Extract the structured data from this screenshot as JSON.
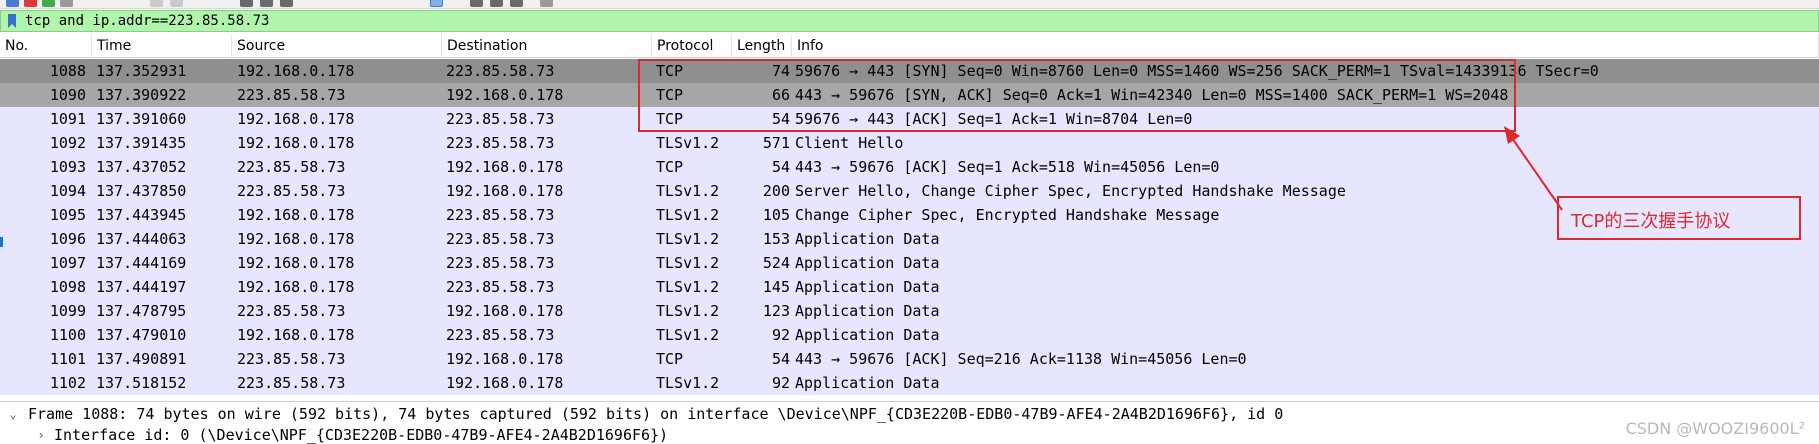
{
  "filter": {
    "expression": "tcp and ip.addr==223.85.58.73"
  },
  "columns": [
    "No.",
    "Time",
    "Source",
    "Destination",
    "Protocol",
    "Length",
    "Info"
  ],
  "packets": [
    {
      "no": "1088",
      "time": "137.352931",
      "src": "192.168.0.178",
      "dst": "223.85.58.73",
      "proto": "TCP",
      "len": "74",
      "info": "59676 → 443 [SYN] Seq=0 Win=8760 Len=0 MSS=1460 WS=256 SACK_PERM=1 TSval=14339136 TSecr=0"
    },
    {
      "no": "1090",
      "time": "137.390922",
      "src": "223.85.58.73",
      "dst": "192.168.0.178",
      "proto": "TCP",
      "len": "66",
      "info": "443 → 59676 [SYN, ACK] Seq=0 Ack=1 Win=42340 Len=0 MSS=1400 SACK_PERM=1 WS=2048"
    },
    {
      "no": "1091",
      "time": "137.391060",
      "src": "192.168.0.178",
      "dst": "223.85.58.73",
      "proto": "TCP",
      "len": "54",
      "info": "59676 → 443 [ACK] Seq=1 Ack=1 Win=8704 Len=0"
    },
    {
      "no": "1092",
      "time": "137.391435",
      "src": "192.168.0.178",
      "dst": "223.85.58.73",
      "proto": "TLSv1.2",
      "len": "571",
      "info": "Client Hello"
    },
    {
      "no": "1093",
      "time": "137.437052",
      "src": "223.85.58.73",
      "dst": "192.168.0.178",
      "proto": "TCP",
      "len": "54",
      "info": "443 → 59676 [ACK] Seq=1 Ack=518 Win=45056 Len=0"
    },
    {
      "no": "1094",
      "time": "137.437850",
      "src": "223.85.58.73",
      "dst": "192.168.0.178",
      "proto": "TLSv1.2",
      "len": "200",
      "info": "Server Hello, Change Cipher Spec, Encrypted Handshake Message"
    },
    {
      "no": "1095",
      "time": "137.443945",
      "src": "192.168.0.178",
      "dst": "223.85.58.73",
      "proto": "TLSv1.2",
      "len": "105",
      "info": "Change Cipher Spec, Encrypted Handshake Message"
    },
    {
      "no": "1096",
      "time": "137.444063",
      "src": "192.168.0.178",
      "dst": "223.85.58.73",
      "proto": "TLSv1.2",
      "len": "153",
      "info": "Application Data"
    },
    {
      "no": "1097",
      "time": "137.444169",
      "src": "192.168.0.178",
      "dst": "223.85.58.73",
      "proto": "TLSv1.2",
      "len": "524",
      "info": "Application Data"
    },
    {
      "no": "1098",
      "time": "137.444197",
      "src": "192.168.0.178",
      "dst": "223.85.58.73",
      "proto": "TLSv1.2",
      "len": "145",
      "info": "Application Data"
    },
    {
      "no": "1099",
      "time": "137.478795",
      "src": "223.85.58.73",
      "dst": "192.168.0.178",
      "proto": "TLSv1.2",
      "len": "123",
      "info": "Application Data"
    },
    {
      "no": "1100",
      "time": "137.479010",
      "src": "192.168.0.178",
      "dst": "223.85.58.73",
      "proto": "TLSv1.2",
      "len": "92",
      "info": "Application Data"
    },
    {
      "no": "1101",
      "time": "137.490891",
      "src": "223.85.58.73",
      "dst": "192.168.0.178",
      "proto": "TCP",
      "len": "54",
      "info": "443 → 59676 [ACK] Seq=216 Ack=1138 Win=45056 Len=0"
    },
    {
      "no": "1102",
      "time": "137.518152",
      "src": "223.85.58.73",
      "dst": "192.168.0.178",
      "proto": "TLSv1.2",
      "len": "92",
      "info": "Application Data"
    }
  ],
  "annotation": {
    "callout_text": "TCP的三次握手协议"
  },
  "detail": {
    "frame_line": "Frame 1088: 74 bytes on wire (592 bits), 74 bytes captured (592 bits) on interface \\Device\\NPF_{CD3E220B-EDB0-47B9-AFE4-2A4B2D1696F6}, id 0",
    "interface_line": "Interface id: 0 (\\Device\\NPF_{CD3E220B-EDB0-47B9-AFE4-2A4B2D1696F6})",
    "expanded_icon": "chevron-down-icon",
    "collapsed_icon": "chevron-right-icon"
  },
  "watermark": "CSDN @WOOZI9600L²",
  "colors": {
    "filter_valid": "#aff5ab",
    "tcp_row": "#e7e6ff",
    "selected_row": "#8f8f8f",
    "annotation": "#e0282e"
  }
}
